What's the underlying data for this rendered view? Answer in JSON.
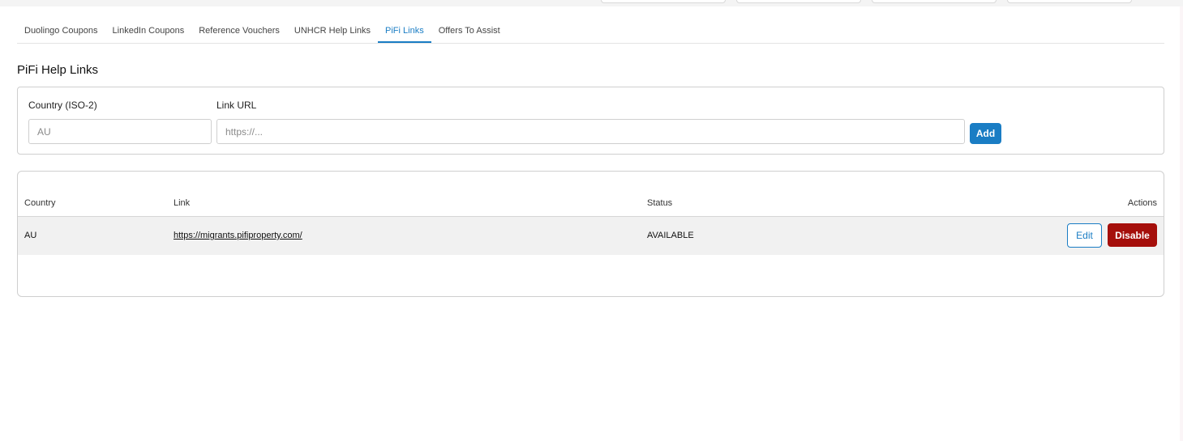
{
  "tabs": [
    {
      "label": "Duolingo Coupons",
      "active": false
    },
    {
      "label": "LinkedIn Coupons",
      "active": false
    },
    {
      "label": "Reference Vouchers",
      "active": false
    },
    {
      "label": "UNHCR Help Links",
      "active": false
    },
    {
      "label": "PiFi Links",
      "active": true
    },
    {
      "label": "Offers To Assist",
      "active": false
    }
  ],
  "section": {
    "title": "PiFi Help Links"
  },
  "form": {
    "country_label": "Country (ISO-2)",
    "country_placeholder": "AU",
    "url_label": "Link URL",
    "url_placeholder": "https://...",
    "add_label": "Add"
  },
  "table": {
    "columns": {
      "country": "Country",
      "link": "Link",
      "status": "Status",
      "actions": "Actions"
    },
    "rows": [
      {
        "country": "AU",
        "link": "https://migrants.pifiproperty.com/",
        "status": "AVAILABLE",
        "edit_label": "Edit",
        "disable_label": "Disable"
      }
    ]
  },
  "colors": {
    "accent": "#1a7dc4",
    "danger": "#a50f0b",
    "row_background": "#f1f1f1"
  }
}
